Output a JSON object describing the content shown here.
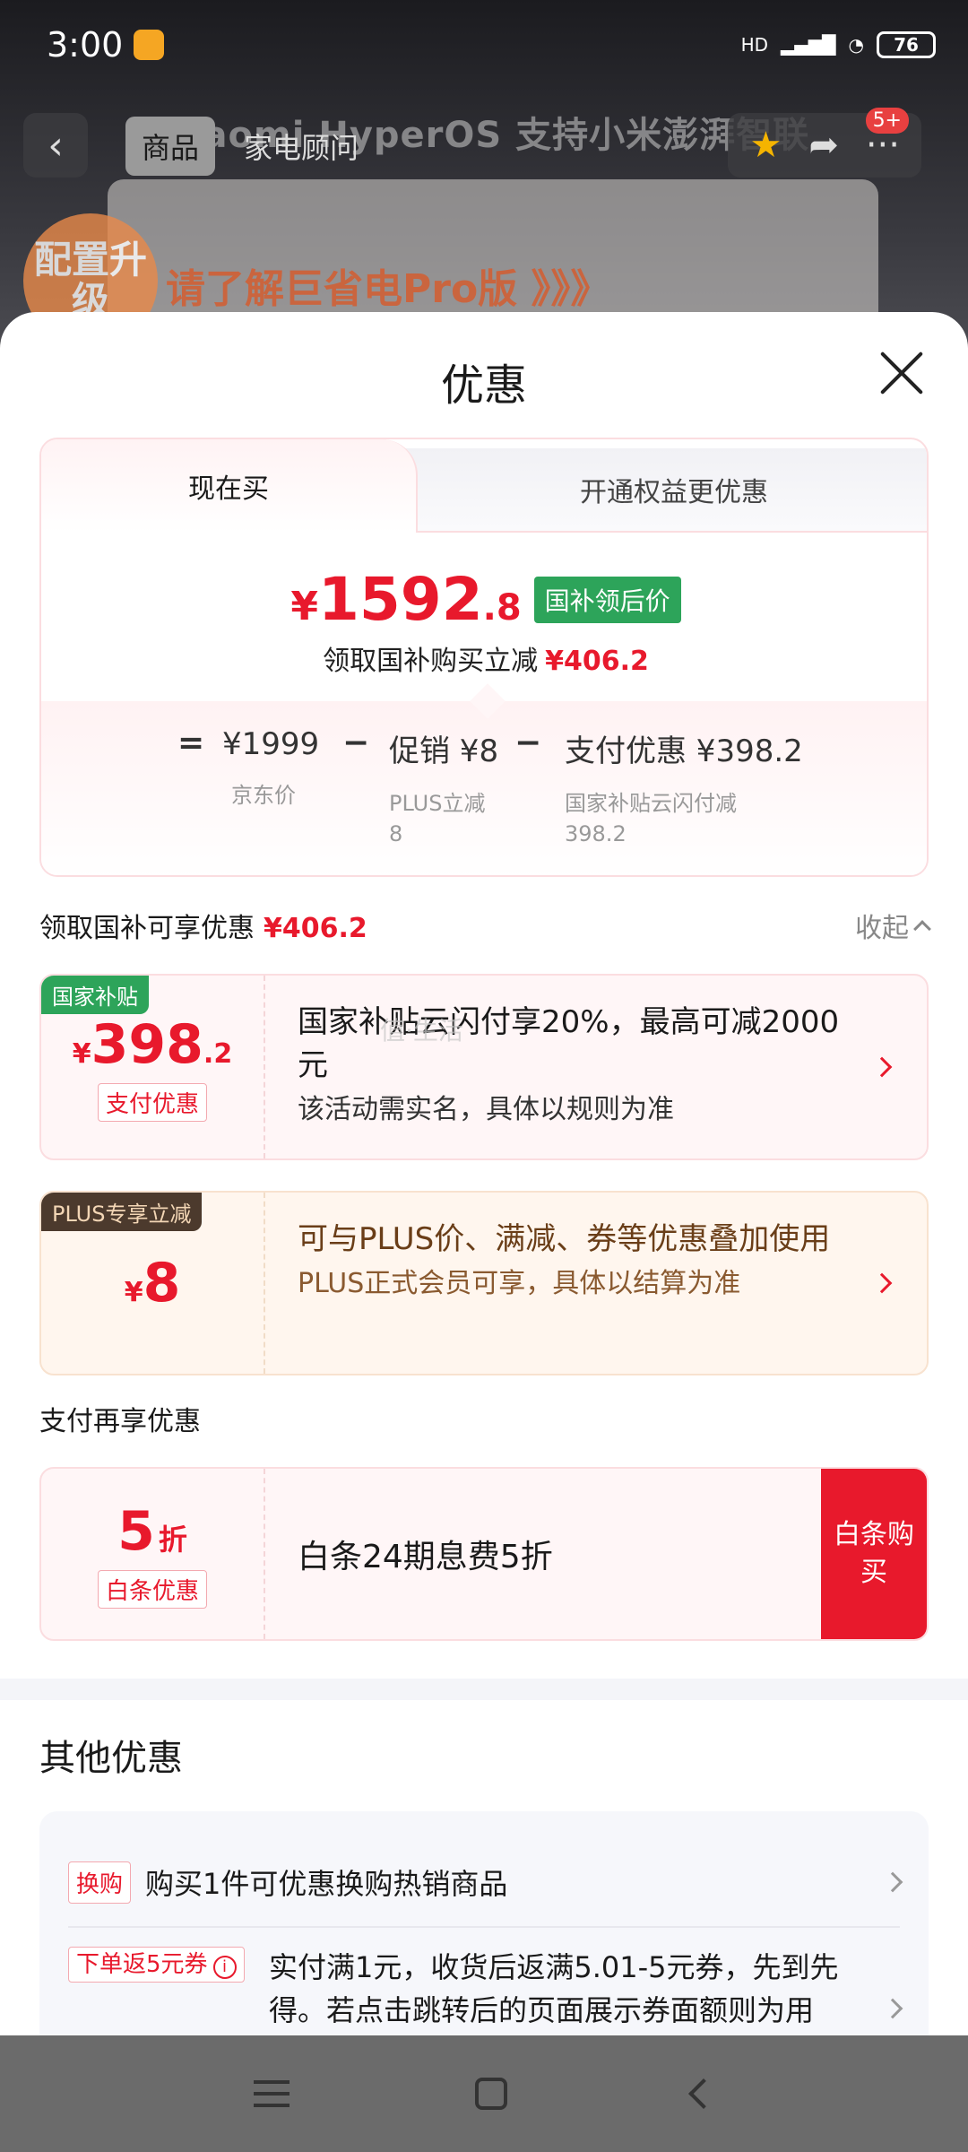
{
  "status_bar": {
    "time": "3:00",
    "network": "HD",
    "battery": "76"
  },
  "background": {
    "banner_text": "Xiaomi HyperOS 支持小米澎湃智联",
    "promo_text": "请了解巨省电Pro版 》》》",
    "badge_text": "配置升级"
  },
  "top_nav": {
    "tabs": [
      {
        "label": "商品"
      },
      {
        "label": "家电顾问"
      }
    ],
    "badge": "5+"
  },
  "sheet": {
    "title": "优惠",
    "tabs": {
      "now": "现在买",
      "member": "开通权益更优惠"
    },
    "price": {
      "yen": "¥",
      "integer": "1592",
      "decimal": ".8",
      "tag": "国补领后价",
      "sub_label": "领取国补购买立减",
      "sub_value": "¥406.2"
    },
    "breakdown": {
      "eq": "=",
      "minus": "−",
      "jd_price": "¥1999",
      "jd_label": "京东价",
      "promo_value": "促销 ¥8",
      "promo_label": "PLUS立减",
      "promo_amount": "8",
      "pay_value": "支付优惠 ¥398.2",
      "pay_label": "国家补贴云闪付减",
      "pay_amount": "398.2"
    },
    "section_head": {
      "label": "领取国补可享优惠",
      "value": "¥406.2",
      "collapse": "收起"
    },
    "offers": {
      "gov": {
        "tag": "国家补贴",
        "yen": "¥",
        "int": "398",
        "dec": ".2",
        "label": "支付优惠",
        "main": "国家补贴云闪付享20%，最高可减2000元",
        "sub": "该活动需实名，具体以规则为准"
      },
      "plus": {
        "tag": "PLUS专享立减",
        "yen": "¥",
        "int": "8",
        "main": "可与PLUS价、满减、券等优惠叠加使用",
        "sub": "PLUS正式会员可享，具体以结算为准"
      }
    },
    "pay_head": "支付再享优惠",
    "baitiao": {
      "num": "5",
      "unit": "折",
      "label": "白条优惠",
      "text": "白条24期息费5折",
      "buy": "白条购买"
    },
    "other": {
      "title": "其他优惠",
      "rows": [
        {
          "pill": "换购",
          "text": "购买1件可优惠换购热销商品"
        },
        {
          "pill": "下单返5元券",
          "text": "实付满1元，收货后返满5.01-5元券，先到先得。若点击跳转后的页面展示券面额则为用"
        }
      ]
    },
    "watermark": "值·生活"
  }
}
